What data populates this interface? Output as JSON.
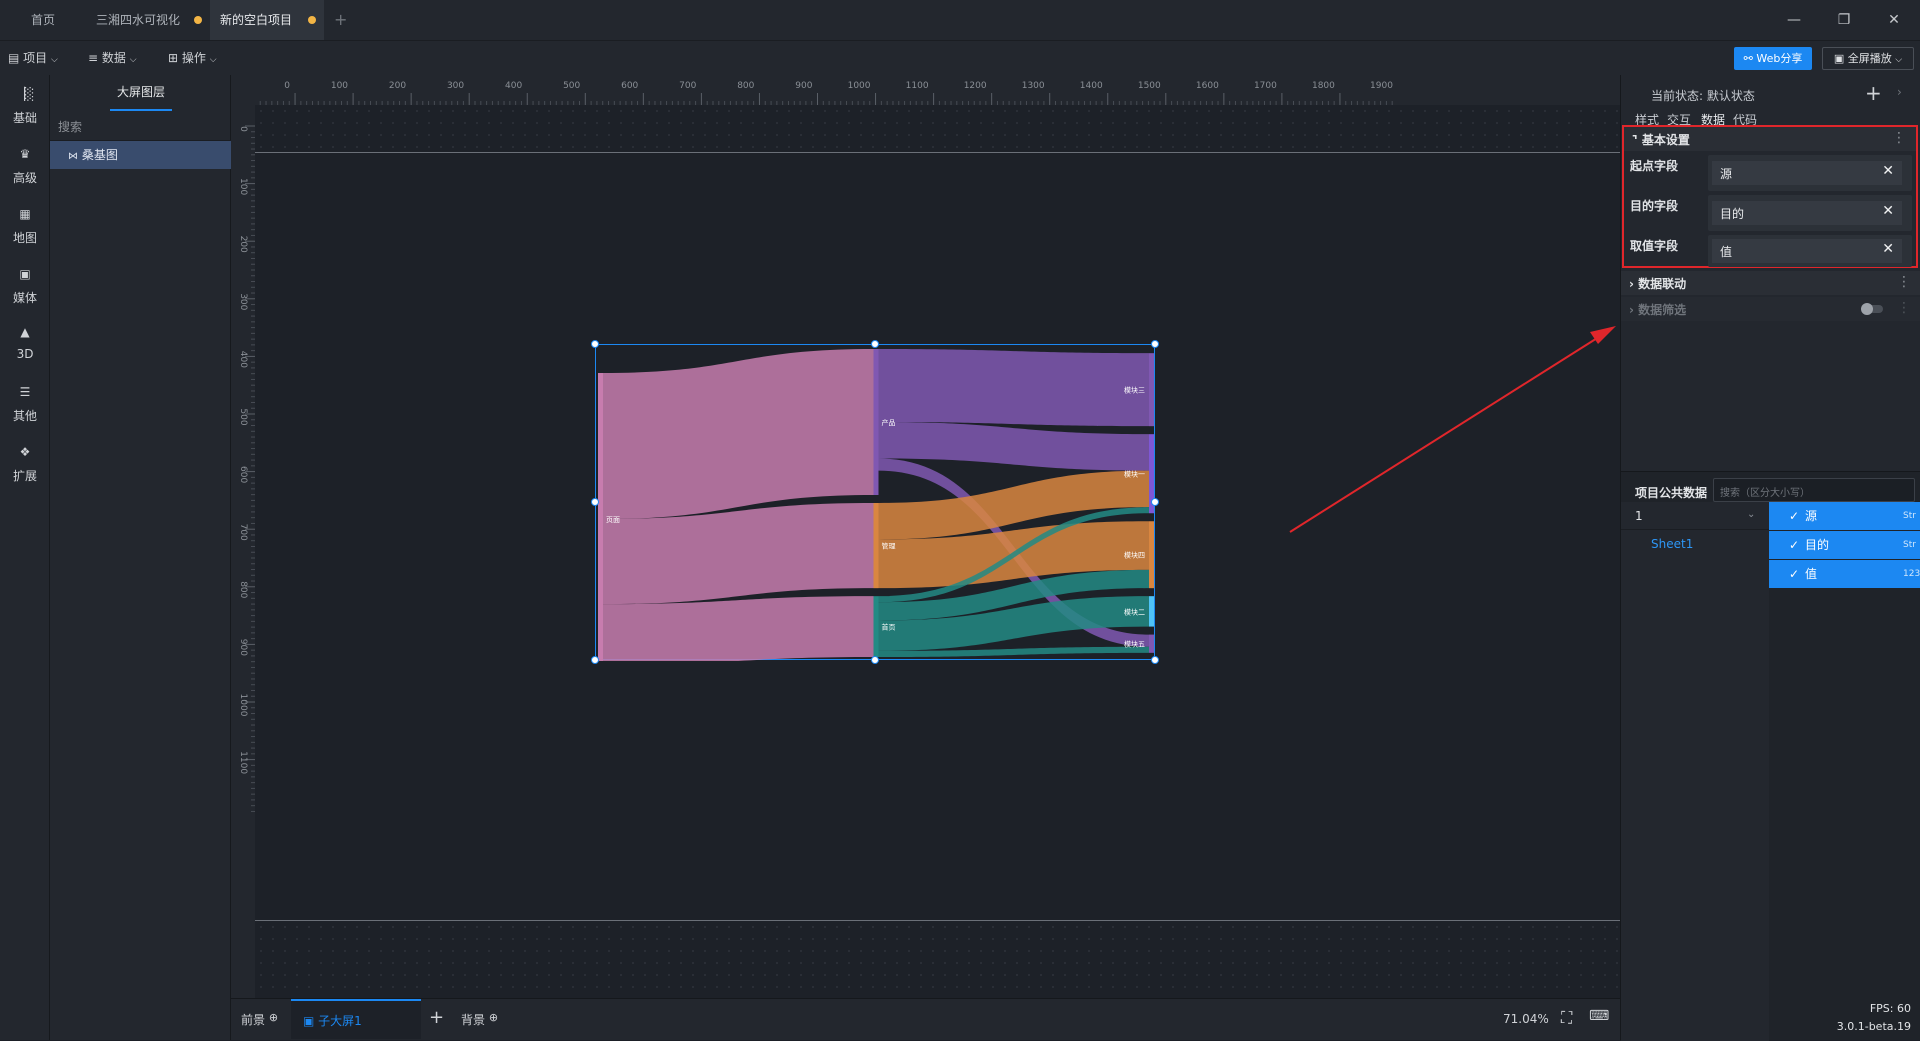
{
  "tabs": [
    {
      "label": "首页",
      "modified": false,
      "active": false
    },
    {
      "label": "三湘四水可视化",
      "modified": true,
      "active": false
    },
    {
      "label": "新的空白项目",
      "modified": true,
      "active": true
    }
  ],
  "toolbar": {
    "project": "项目",
    "data": "数据",
    "operate": "操作",
    "web_share": "Web分享",
    "fullscreen": "全屏播放"
  },
  "sidebar_icons": [
    {
      "label": "基础",
      "icon": "bar-chart-icon"
    },
    {
      "label": "高级",
      "icon": "crown-icon"
    },
    {
      "label": "地图",
      "icon": "map-icon"
    },
    {
      "label": "媒体",
      "icon": "camera-icon"
    },
    {
      "label": "3D",
      "icon": "cube-icon"
    },
    {
      "label": "其他",
      "icon": "list-icon"
    },
    {
      "label": "扩展",
      "icon": "puzzle-icon"
    }
  ],
  "layer_panel": {
    "tab_label": "大屏图层",
    "search_placeholder": "搜索",
    "layers": [
      {
        "label": "桑基图",
        "selected": true
      }
    ]
  },
  "ruler": {
    "top_ticks": [
      "0",
      "100",
      "200",
      "300",
      "400",
      "500",
      "600",
      "700",
      "800",
      "900",
      "1000",
      "1100",
      "1200",
      "1300",
      "1400",
      "1500",
      "1600",
      "1700",
      "1800",
      "1900"
    ],
    "left_ticks": [
      "0",
      "100",
      "200",
      "300",
      "400",
      "500",
      "600",
      "700",
      "800",
      "900",
      "1000",
      "1100"
    ]
  },
  "chart_data": {
    "type": "sankey",
    "nodes": [
      "页面",
      "产品",
      "管理",
      "首页",
      "模块三",
      "模块一",
      "模块四",
      "模块二",
      "模块五"
    ],
    "links": [
      {
        "source": "页面",
        "target": "产品",
        "value": 24
      },
      {
        "source": "页面",
        "target": "管理",
        "value": 14
      },
      {
        "source": "页面",
        "target": "首页",
        "value": 10
      },
      {
        "source": "产品",
        "target": "模块三",
        "value": 12
      },
      {
        "source": "产品",
        "target": "模块一",
        "value": 6
      },
      {
        "source": "产品",
        "target": "模块五",
        "value": 2
      },
      {
        "source": "管理",
        "target": "模块一",
        "value": 6
      },
      {
        "source": "管理",
        "target": "模块四",
        "value": 8
      },
      {
        "source": "首页",
        "target": "模块一",
        "value": 1
      },
      {
        "source": "首页",
        "target": "模块四",
        "value": 3
      },
      {
        "source": "首页",
        "target": "模块二",
        "value": 5
      },
      {
        "source": "首页",
        "target": "模块五",
        "value": 1
      }
    ],
    "colors": {
      "页面": "#c77cae",
      "产品": "#8058b2",
      "管理": "#d98640",
      "首页": "#238a84",
      "模块三": "#8058b2",
      "模块一": "#7e57d6",
      "模块四": "#d98640",
      "模块二": "#4fc3f7",
      "模块五": "#8058b2"
    }
  },
  "bottom": {
    "foreground": "前景",
    "sub_screen": "子大屏1",
    "background": "背景",
    "zoom": "71.04%"
  },
  "right_panel": {
    "state_label": "当前状态:",
    "state_value": "默认状态",
    "tabs": [
      "样式",
      "交互",
      "数据",
      "代码"
    ],
    "active_tab": "数据",
    "basic_settings": "基本设置",
    "fields": [
      {
        "label": "起点字段",
        "value": "源"
      },
      {
        "label": "目的字段",
        "value": "目的"
      },
      {
        "label": "取值字段",
        "value": "值"
      }
    ],
    "data_link": "数据联动",
    "data_filter": "数据筛选",
    "public_data_label": "项目公共数据",
    "public_data_search_placeholder": "搜索（区分大小写）",
    "dataset": "1",
    "sheet": "Sheet1",
    "columns": [
      {
        "name": "源",
        "type": "Str"
      },
      {
        "name": "目的",
        "type": "Str"
      },
      {
        "name": "值",
        "type": "123"
      }
    ],
    "fps": "FPS: 60",
    "version": "3.0.1-beta.19"
  },
  "accent_color": "#1c88f2",
  "annotation_color": "#e0262b"
}
